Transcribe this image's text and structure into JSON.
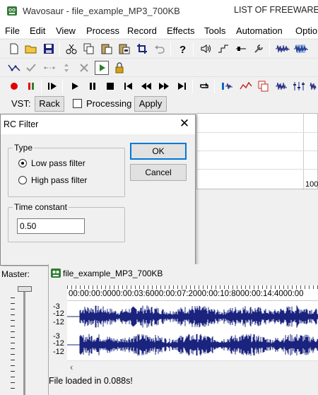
{
  "window": {
    "title": "Wavosaur - file_example_MP3_700KB",
    "watermark": "LIST OF FREEWARE"
  },
  "menu": [
    "File",
    "Edit",
    "View",
    "Process",
    "Record",
    "Effects",
    "Tools",
    "Automation",
    "Optio"
  ],
  "vst_bar": {
    "label": "VST:",
    "rack_label": "Rack",
    "processing_label": "Processing",
    "apply_label": "Apply"
  },
  "right_panel": {
    "value": "100"
  },
  "dialog": {
    "title": "RC Filter",
    "close_symbol": "✕",
    "type_group": "Type",
    "low_pass": "Low pass filter",
    "high_pass": "High pass filter",
    "selected": "low_pass",
    "time_group": "Time constant",
    "time_value": "0.50",
    "ok_label": "OK",
    "cancel_label": "Cancel"
  },
  "master_label": "Master:",
  "document": {
    "title": "file_example_MP3_700KB",
    "timeline": "00:00:00:0000:00:03:6000:00:07:2000:00:10:8000:00:14:4000:00",
    "channel_ticks": [
      "-3",
      "-12",
      "-12",
      "-3",
      "-12",
      "-12"
    ],
    "status": "File loaded in 0.088s!"
  },
  "colors": {
    "waveform": "#1a237e",
    "record": "#e00000",
    "accent": "#0078d7"
  },
  "icons": {
    "toolbar1": [
      "new-file-icon",
      "open-folder-icon",
      "save-icon",
      "cut-icon",
      "copy-icon",
      "paste-icon",
      "paste-new-icon",
      "crop-icon",
      "undo-icon",
      "help-icon",
      "speaker-icon",
      "envelope-icon",
      "marker-icon",
      "wrench-icon",
      "waveform-icon",
      "waveform-icon"
    ],
    "toolbar2": [
      "envelope-line-icon",
      "check-icon",
      "dotted-line-icon",
      "updown-icon",
      "close-x-icon",
      "play-box-icon",
      "lock-icon"
    ],
    "toolbar3": [
      "record-icon",
      "pause-record-icon",
      "play-from-start-icon",
      "play-icon",
      "pause-icon",
      "stop-icon",
      "go-start-icon",
      "rewind-icon",
      "forward-icon",
      "go-end-icon",
      "loop-icon",
      "spectrum-icon",
      "graph-icon",
      "copy-red-icon",
      "waveform-icon",
      "eq-icon",
      "waveform-icon"
    ]
  }
}
